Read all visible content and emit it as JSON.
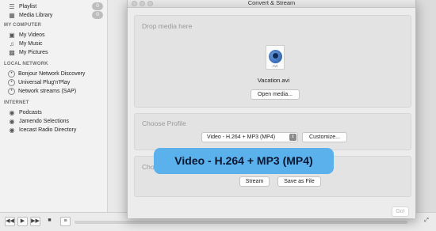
{
  "sidebar": {
    "playlist": {
      "label": "Playlist",
      "count": "0"
    },
    "media_library": {
      "label": "Media Library",
      "count": "0"
    },
    "my_computer": {
      "heading": "MY COMPUTER",
      "items": [
        {
          "label": "My Videos",
          "icon": "film-icon"
        },
        {
          "label": "My Music",
          "icon": "music-note-icon"
        },
        {
          "label": "My Pictures",
          "icon": "picture-icon"
        }
      ]
    },
    "local_network": {
      "heading": "LOCAL NETWORK",
      "items": [
        {
          "label": "Bonjour Network Discovery",
          "icon": "network-icon"
        },
        {
          "label": "Universal Plug'n'Play",
          "icon": "network-icon"
        },
        {
          "label": "Network streams (SAP)",
          "icon": "network-icon"
        }
      ]
    },
    "internet": {
      "heading": "INTERNET",
      "items": [
        {
          "label": "Podcasts",
          "icon": "podcast-icon"
        },
        {
          "label": "Jamendo Selections",
          "icon": "podcast-icon"
        },
        {
          "label": "Icecast Radio Directory",
          "icon": "podcast-icon"
        }
      ]
    }
  },
  "dialog": {
    "title": "Convert & Stream",
    "drop_section": {
      "title": "Drop media here",
      "file_name": "Vacation.avi",
      "file_ext": "AVI",
      "open_button": "Open media..."
    },
    "profile_section": {
      "title": "Choose Profile",
      "selected_profile": "Video - H.264 + MP3 (MP4)",
      "customize_button": "Customize..."
    },
    "destination_section": {
      "title": "Cho",
      "stream_button": "Stream",
      "save_button": "Save as File"
    },
    "go_button": "Go!"
  },
  "tooltip": {
    "text": "Video - H.264 + MP3 (MP4)"
  },
  "colors": {
    "tooltip_bg": "#5ab1ec",
    "dialog_bg": "#ececec",
    "sidebar_bg": "#f2f2f2"
  }
}
